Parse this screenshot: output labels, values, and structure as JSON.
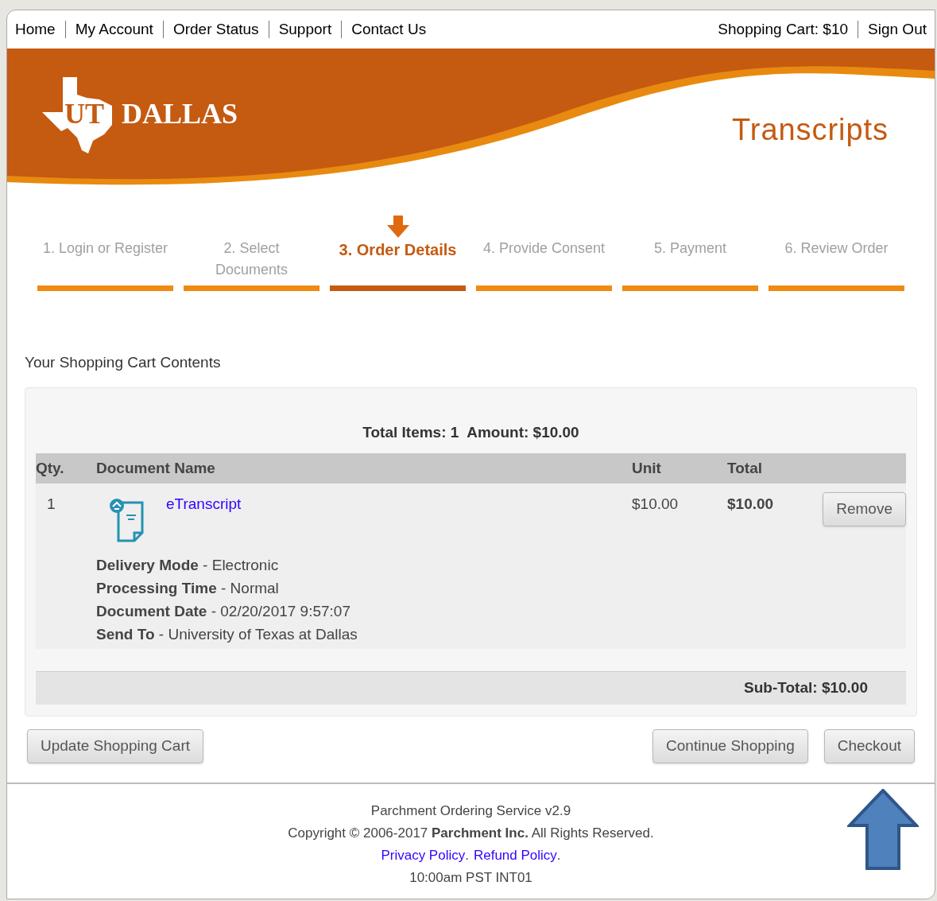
{
  "top_nav": {
    "links": [
      "Home",
      "My Account",
      "Order Status",
      "Support",
      "Contact Us"
    ],
    "cart": "Shopping Cart: $10",
    "sign_out": "Sign Out"
  },
  "banner": {
    "logo_mark": "UT",
    "logo_word": "DALLAS",
    "title": "Transcripts"
  },
  "steps": [
    {
      "label": "1. Login or Register",
      "selected": false
    },
    {
      "label": "2. Select Documents",
      "selected": false
    },
    {
      "label": "3. Order Details",
      "selected": true
    },
    {
      "label": "4. Provide Consent",
      "selected": false
    },
    {
      "label": "5. Payment",
      "selected": false
    },
    {
      "label": "6. Review Order",
      "selected": false
    }
  ],
  "cart": {
    "heading": "Your Shopping Cart Contents",
    "summary": "Total Items: 1  Amount: $10.00",
    "columns": [
      "Qty.",
      "Document Name",
      "Unit",
      "Total"
    ],
    "rows": [
      {
        "qty": "1",
        "name": "eTranscript",
        "unit": "$10.00",
        "total": "$10.00",
        "remove": "Remove",
        "details": [
          "**Delivery Mode** - Electronic",
          "**Processing Time** - Normal",
          "**Document Date** - 02/20/2017 9:57:07",
          "**Send To** - University of Texas at Dallas"
        ]
      }
    ],
    "subtotal": "Sub-Total: $10.00"
  },
  "buttons": {
    "update": "Update Shopping Cart",
    "continue": "Continue Shopping",
    "checkout": "Checkout"
  },
  "footer": {
    "service": "Parchment Ordering Service v2.9",
    "copyright": "Copyright © 2006-2017 **Parchment Inc.** All Rights Reserved.",
    "links": [
      {
        "label": "Privacy Policy",
        "after": "."
      },
      {
        "label": "Refund Policy",
        "after": "."
      }
    ],
    "time": "10:00am PST INT01"
  }
}
